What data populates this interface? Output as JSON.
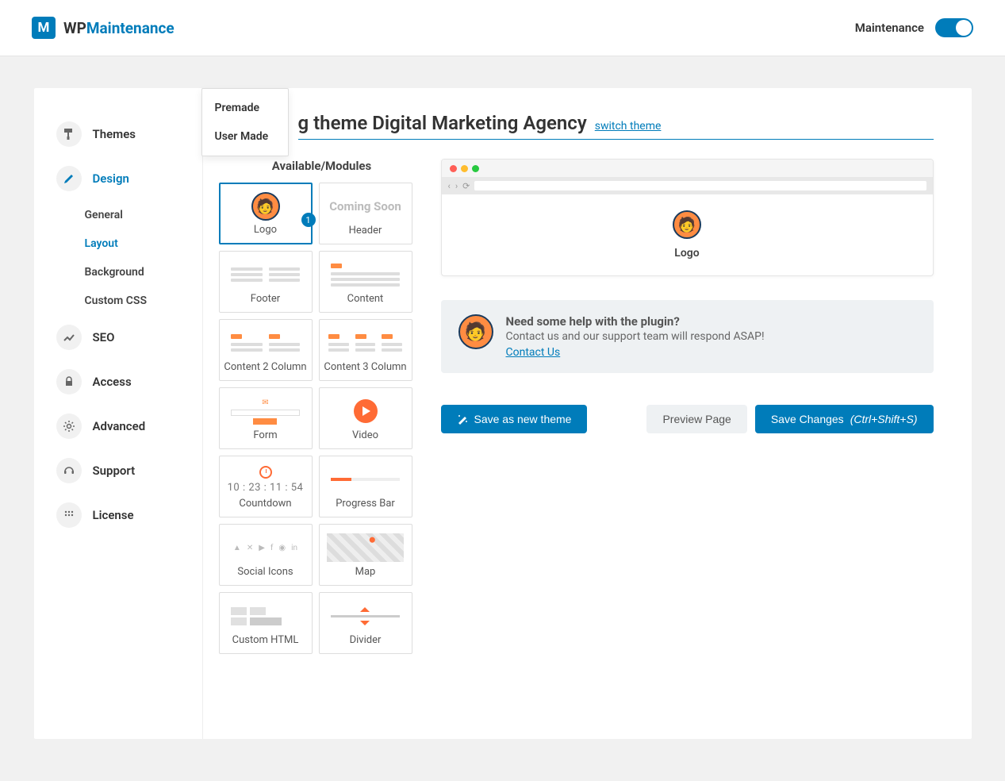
{
  "header": {
    "logo_glyph": "M",
    "logo_prefix": "WP",
    "logo_suffix": "Maintenance",
    "maintenance_label": "Maintenance"
  },
  "sidebar": {
    "items": [
      {
        "label": "Themes"
      },
      {
        "label": "Design"
      },
      {
        "label": "SEO"
      },
      {
        "label": "Access"
      },
      {
        "label": "Advanced"
      },
      {
        "label": "Support"
      },
      {
        "label": "License"
      }
    ],
    "design_sub": [
      {
        "label": "General"
      },
      {
        "label": "Layout"
      },
      {
        "label": "Background"
      },
      {
        "label": "Custom CSS"
      }
    ]
  },
  "dropdown": {
    "items": [
      {
        "label": "Premade"
      },
      {
        "label": "User Made"
      }
    ]
  },
  "page": {
    "title_partial": "g theme Digital Marketing Agency",
    "switch_link": "switch theme"
  },
  "modules": {
    "heading": "Available/Modules",
    "items": [
      {
        "label": "Logo",
        "badge": "1"
      },
      {
        "label": "Header",
        "hint": "Coming Soon"
      },
      {
        "label": "Footer"
      },
      {
        "label": "Content"
      },
      {
        "label": "Content 2 Column"
      },
      {
        "label": "Content 3 Column"
      },
      {
        "label": "Form"
      },
      {
        "label": "Video"
      },
      {
        "label": "Countdown",
        "time": "10 : 23 : 11 : 54"
      },
      {
        "label": "Progress Bar"
      },
      {
        "label": "Social Icons"
      },
      {
        "label": "Map"
      },
      {
        "label": "Custom HTML"
      },
      {
        "label": "Divider"
      }
    ]
  },
  "preview": {
    "caption": "Logo"
  },
  "help": {
    "title": "Need some help with the plugin?",
    "text": "Contact us and our support team will respond ASAP!",
    "link": "Contact Us"
  },
  "actions": {
    "save_as_new": "Save as new theme",
    "preview": "Preview Page",
    "save": "Save Changes",
    "shortcut": "(Ctrl+Shift+S)"
  }
}
